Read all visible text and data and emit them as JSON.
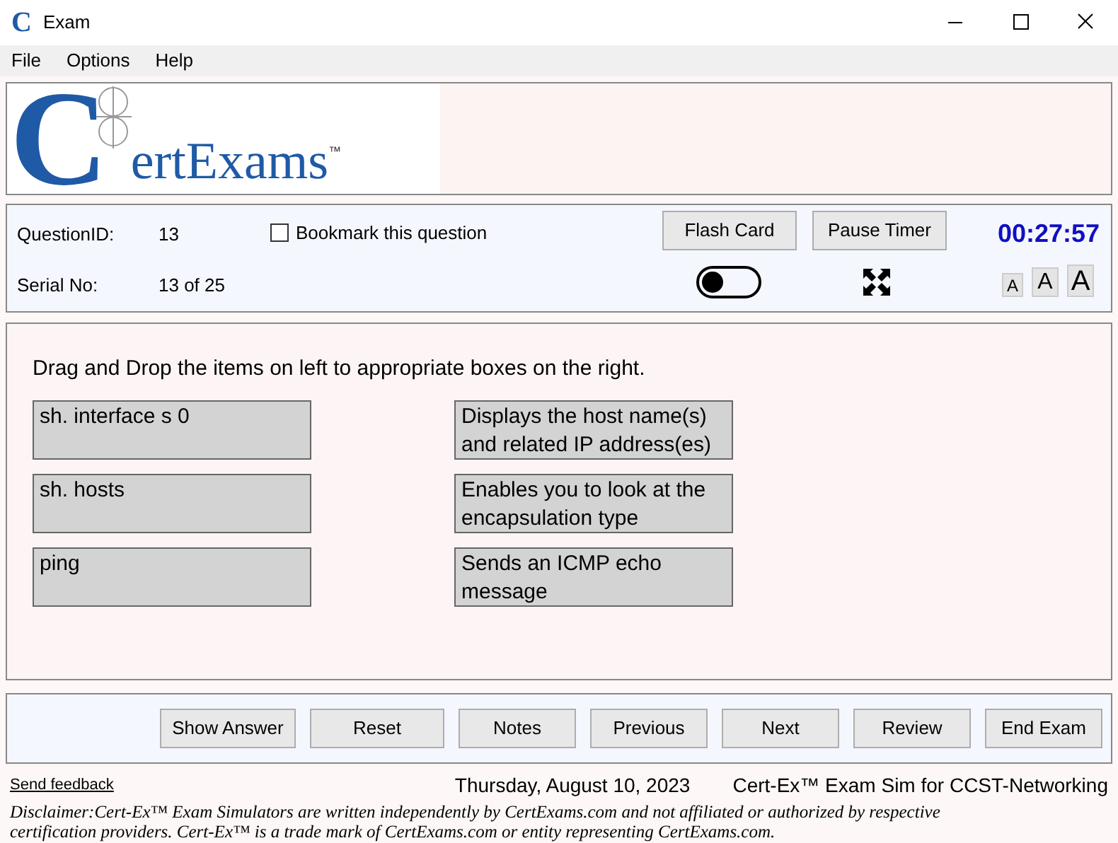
{
  "window": {
    "title": "Exam",
    "app_icon": "C"
  },
  "menu": [
    "File",
    "Options",
    "Help"
  ],
  "logo": {
    "initial": "C",
    "rest": "ertExams",
    "mark": "™"
  },
  "info": {
    "question_id_label": "QuestionID:",
    "question_id": "13",
    "serial_label": "Serial No:",
    "serial": "13 of 25",
    "bookmark": {
      "label": "Bookmark this question",
      "checked": false
    },
    "flash_card": "Flash Card",
    "pause_timer": "Pause Timer",
    "timer": "00:27:57",
    "dark_mode": {
      "on": false
    },
    "font_sizes": [
      "A",
      "A",
      "A"
    ]
  },
  "question": {
    "prompt": "Drag and Drop the items on left to appropriate boxes on the right.",
    "items": [
      {
        "left": "sh. interface s 0",
        "right": "Displays the host name(s) and related IP address(es)"
      },
      {
        "left": "sh. hosts",
        "right": "Enables you to look at the encapsulation type"
      },
      {
        "left": "ping",
        "right": "Sends an ICMP echo message"
      }
    ]
  },
  "buttons": [
    "Show Answer",
    "Reset",
    "Notes",
    "Previous",
    "Next",
    "Review",
    "End Exam"
  ],
  "footer": {
    "feedback": "Send feedback",
    "date": "Thursday, August 10, 2023",
    "product": "Cert-Ex™ Exam Sim for CCST-Networking",
    "disclaimer": "Disclaimer:Cert-Ex™ Exam Simulators are written independently by CertExams.com and not affiliated or authorized by respective certification providers. Cert-Ex™ is a trade mark of CertExams.com or entity representing CertExams.com."
  }
}
